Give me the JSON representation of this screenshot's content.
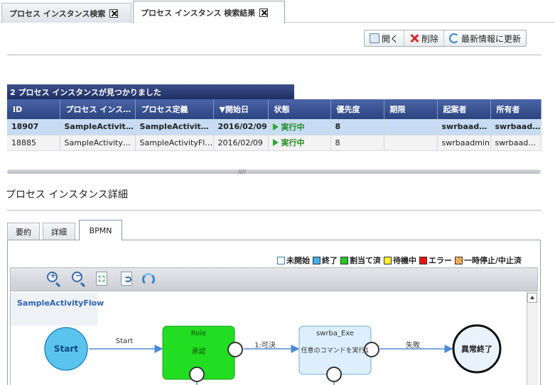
{
  "top_tabs": [
    {
      "label": "プロセス インスタンス検索"
    },
    {
      "label": "プロセス インスタンス 検索結果"
    }
  ],
  "toolbar": {
    "open_label": "開く",
    "delete_label": "削除",
    "refresh_label": "最新情報に更新"
  },
  "result": {
    "count_text": "2 プロセス インスタンスが見つかりました",
    "columns": [
      "ID",
      "プロセス インス…",
      "プロセス定義",
      "▼開始日",
      "状態",
      "優先度",
      "期限",
      "起案者",
      "所有者"
    ],
    "rows": [
      {
        "id": "18907",
        "instance": "SampleActivityFl...",
        "definition": "SampleActivityFl...",
        "start": "2016/02/09",
        "status": "実行中",
        "priority": "8",
        "due": "",
        "drafter": "swrbaadm...",
        "owner": "swrbaadmin"
      },
      {
        "id": "18885",
        "instance": "SampleActivityFlow",
        "definition": "SampleActivityFlow",
        "start": "2016/02/09",
        "status": "実行中",
        "priority": "8",
        "due": "",
        "drafter": "swrbaadmin",
        "owner": "swrbaadmin"
      }
    ]
  },
  "detail": {
    "title": "プロセス インスタンス詳細",
    "tabs": [
      "要約",
      "詳細",
      "BPMN"
    ]
  },
  "legend": [
    {
      "label": "未開始",
      "color": "#ffffff"
    },
    {
      "label": "終了",
      "color": "#40b0e8"
    },
    {
      "label": "割当て済",
      "color": "#22cc22"
    },
    {
      "label": "待機中",
      "color": "#ffee33"
    },
    {
      "label": "エラー",
      "color": "#ee1111"
    },
    {
      "label": "一時停止/中止済",
      "color": "#f0a050"
    }
  ],
  "bpmn": {
    "flow_name": "SampleActivityFlow",
    "start_label": "Start",
    "edge1_label": "Start",
    "role_title": "Role",
    "role_sub": "承認",
    "edge2_label": "1:可決",
    "exe_title": "swrba_Exe",
    "exe_sub": "任意のコマンドを実行1",
    "edge3_label": "失敗",
    "end_label": "異常終了"
  }
}
